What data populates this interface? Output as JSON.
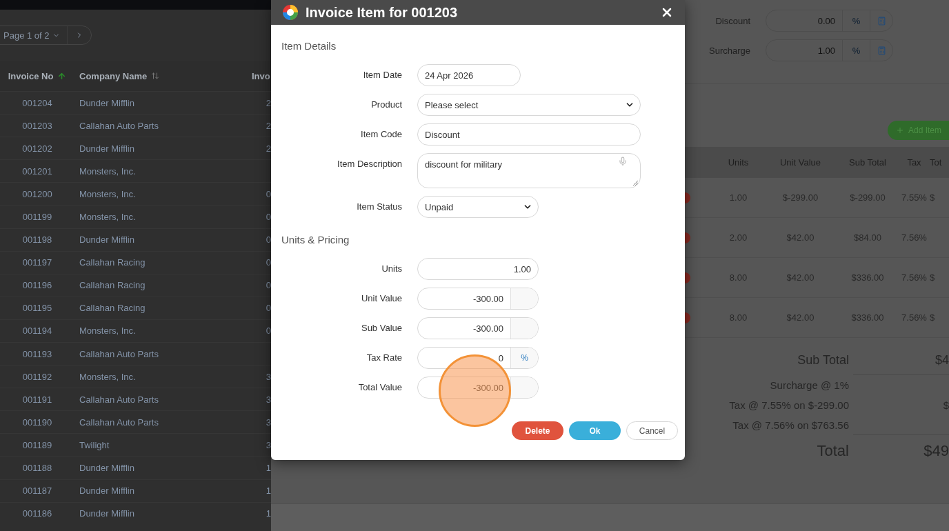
{
  "invoice_list": {
    "pagination": {
      "page_label": "Page 1 of 2"
    },
    "columns": [
      {
        "label": "Invoice No",
        "sort_active": true
      },
      {
        "label": "Company Name",
        "sort_active": false
      },
      {
        "label": "Invo"
      }
    ],
    "rows": [
      {
        "invoice_no": "001204",
        "company": "Dunder Mifflin",
        "column_3": "2"
      },
      {
        "invoice_no": "001203",
        "company": "Callahan Auto Parts",
        "column_3": "2"
      },
      {
        "invoice_no": "001202",
        "company": "Dunder Mifflin",
        "column_3": "2"
      },
      {
        "invoice_no": "001201",
        "company": "Monsters, Inc."
      },
      {
        "invoice_no": "001200",
        "company": "Monsters, Inc.",
        "column_3": "0"
      },
      {
        "invoice_no": "001199",
        "company": "Monsters, Inc.",
        "column_3": "0"
      },
      {
        "invoice_no": "001198",
        "company": "Dunder Mifflin",
        "column_3": "0"
      },
      {
        "invoice_no": "001197",
        "company": "Callahan Racing",
        "column_3": "0"
      },
      {
        "invoice_no": "001196",
        "company": "Callahan Racing",
        "column_3": "0"
      },
      {
        "invoice_no": "001195",
        "company": "Callahan Racing",
        "column_3": "0"
      },
      {
        "invoice_no": "001194",
        "company": "Monsters, Inc.",
        "column_3": "0"
      },
      {
        "invoice_no": "001193",
        "company": "Callahan Auto Parts"
      },
      {
        "invoice_no": "001192",
        "company": "Monsters, Inc.",
        "column_3": "3"
      },
      {
        "invoice_no": "001191",
        "company": "Callahan Auto Parts",
        "column_3": "3"
      },
      {
        "invoice_no": "001190",
        "company": "Callahan Auto Parts",
        "column_3": "3"
      },
      {
        "invoice_no": "001189",
        "company": "Twilight",
        "column_3": "3"
      },
      {
        "invoice_no": "001188",
        "company": "Dunder Mifflin",
        "column_3": "1"
      },
      {
        "invoice_no": "001187",
        "company": "Dunder Mifflin",
        "column_3": "1"
      },
      {
        "invoice_no": "001186",
        "company": "Dunder Mifflin",
        "column_3": "1"
      }
    ]
  },
  "invoice_form": {
    "adjustments": [
      {
        "label": "Discount",
        "value": "0.00",
        "unit": "%"
      },
      {
        "label": "Surcharge",
        "value": "1.00",
        "unit": "%"
      }
    ],
    "add_item_button": "Add Item",
    "items_table": {
      "columns": [
        "Units",
        "Unit Value",
        "Sub Total",
        "Tax",
        "Tot"
      ],
      "rows": [
        {
          "units": "1.00",
          "unit_value": "$-299.00",
          "sub_total": "$-299.00",
          "tax": "7.55%",
          "total": "$"
        },
        {
          "units": "2.00",
          "unit_value": "$42.00",
          "sub_total": "$84.00",
          "tax": "7.56%"
        },
        {
          "units": "8.00",
          "unit_value": "$42.00",
          "sub_total": "$336.00",
          "tax": "7.56%",
          "total": "$"
        },
        {
          "units": "8.00",
          "unit_value": "$42.00",
          "sub_total": "$336.00",
          "tax": "7.56%",
          "total": "$"
        }
      ]
    },
    "totals": [
      {
        "kind": "subtotal",
        "label": "Sub Total",
        "value": "$4"
      },
      {
        "kind": "line",
        "label": "Surcharge @ 1%"
      },
      {
        "kind": "line",
        "label": "Tax @ 7.55% on $-299.00",
        "value": "$"
      },
      {
        "kind": "line",
        "label": "Tax @ 7.56% on $763.56"
      },
      {
        "kind": "grand",
        "label": "Total",
        "value": "$49"
      }
    ]
  },
  "dialog": {
    "title": "Invoice Item for 001203",
    "sections": [
      {
        "title": "Item Details",
        "fields": [
          {
            "label": "Item Date",
            "kind": "date",
            "value": "24 Apr 2026"
          },
          {
            "label": "Product",
            "kind": "select",
            "value": "Please select"
          },
          {
            "label": "Item Code",
            "kind": "text",
            "value": "Discount"
          },
          {
            "label": "Item Description",
            "kind": "textarea",
            "value": "discount for military"
          },
          {
            "label": "Item Status",
            "kind": "short_select",
            "value": "Unpaid"
          }
        ]
      },
      {
        "title": "Units & Pricing",
        "fields": [
          {
            "label": "Units",
            "kind": "number",
            "value": "1.00"
          },
          {
            "label": "Unit Value",
            "kind": "number",
            "value": "-300.00",
            "addon": true
          },
          {
            "label": "Sub Value",
            "kind": "number",
            "value": "-300.00",
            "addon": true
          },
          {
            "label": "Tax Rate",
            "kind": "number",
            "value": "0",
            "addon": true,
            "addon_label": "%"
          },
          {
            "label": "Total Value",
            "kind": "number",
            "value": "-300.00",
            "addon": true
          }
        ]
      }
    ],
    "buttons": [
      {
        "label": "Delete",
        "kind": "danger"
      },
      {
        "label": "Ok",
        "kind": "primary"
      },
      {
        "label": "Cancel",
        "kind": "default"
      }
    ]
  }
}
